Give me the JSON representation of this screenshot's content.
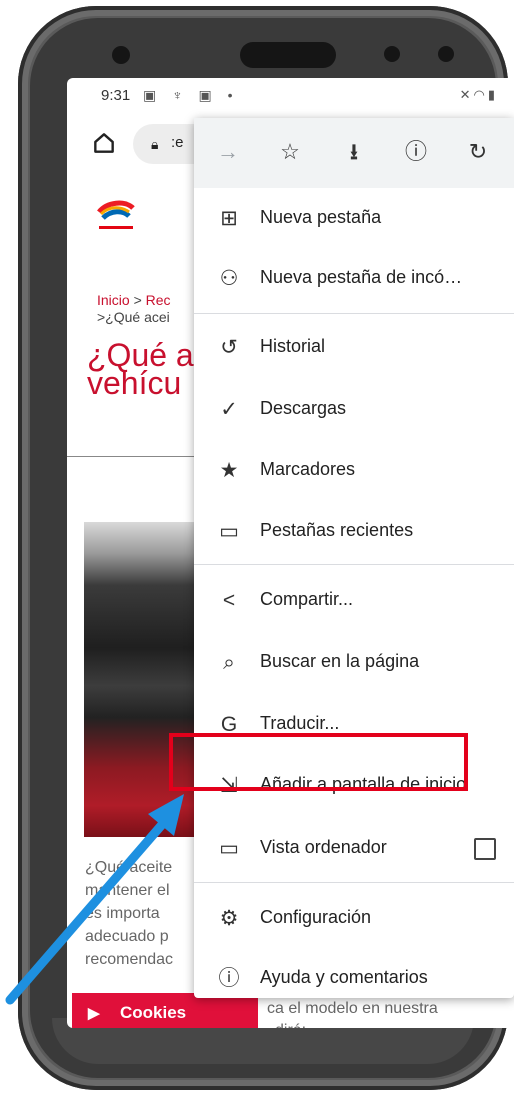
{
  "status": {
    "time": "9:31"
  },
  "browser": {
    "url_text": ":e"
  },
  "page": {
    "breadcrumb_1": "Inicio",
    "breadcrumb_sep": " > ",
    "breadcrumb_2": "Rec",
    "breadcrumb_line2": ">¿Qué acei",
    "headline_line1": "¿Qué a",
    "headline_line2": "vehícu",
    "body_lines": [
      "¿Qué aceite",
      "mantener el",
      "es importa",
      "adecuado p",
      "recomendac"
    ],
    "tail_line1": "ca el modelo en nuestra",
    "tail_line2": "dirá:",
    "cookies_label": "Cookies"
  },
  "menu": {
    "items": [
      {
        "label": "Nueva pestaña",
        "icon": "plus-box-icon"
      },
      {
        "label": "Nueva pestaña de incó…",
        "icon": "incognito-icon"
      },
      {
        "label": "Historial",
        "icon": "history-icon"
      },
      {
        "label": "Descargas",
        "icon": "download-done-icon"
      },
      {
        "label": "Marcadores",
        "icon": "star-icon"
      },
      {
        "label": "Pestañas recientes",
        "icon": "devices-icon"
      },
      {
        "label": "Compartir...",
        "icon": "share-icon"
      },
      {
        "label": "Buscar en la página",
        "icon": "find-in-page-icon"
      },
      {
        "label": "Traducir...",
        "icon": "translate-icon"
      },
      {
        "label": "Añadir a pantalla de inicio",
        "icon": "add-to-home-screen-icon"
      },
      {
        "label": "Vista ordenador",
        "icon": "desktop-icon"
      },
      {
        "label": "Configuración",
        "icon": "gear-icon"
      },
      {
        "label": "Ayuda y comentarios",
        "icon": "help-icon"
      }
    ]
  },
  "colors": {
    "brand_red": "#c8102e",
    "highlight_box": "#e3001b",
    "arrow_blue": "#1e90e0",
    "cookies_bg": "#e0103a"
  }
}
